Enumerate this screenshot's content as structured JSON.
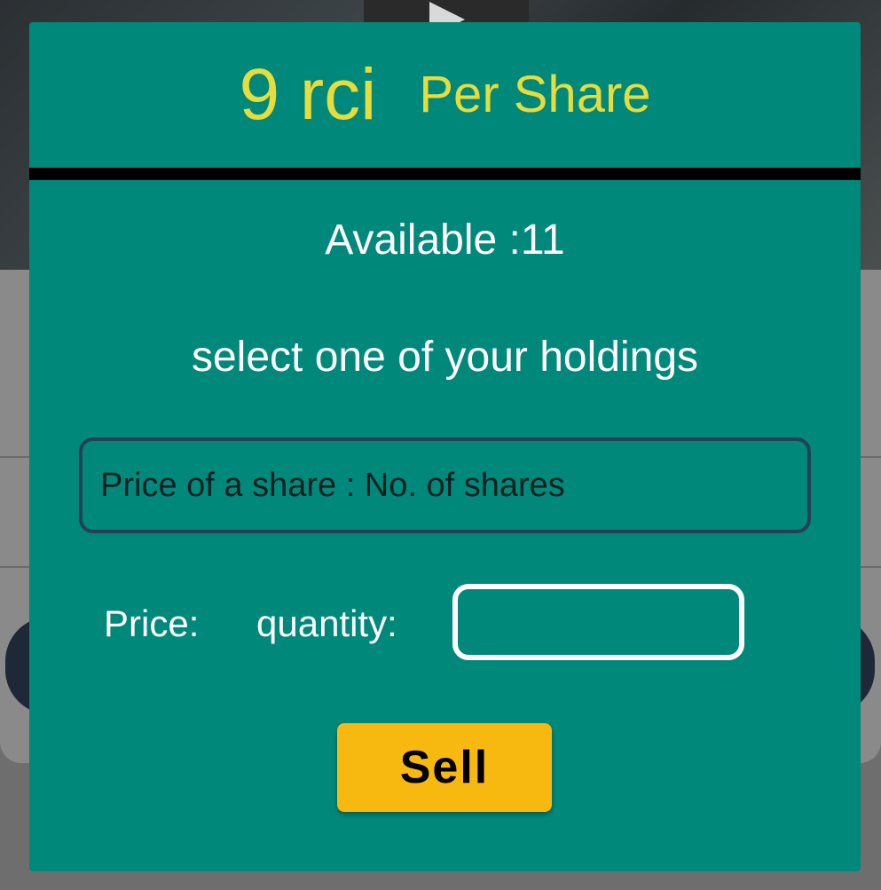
{
  "dialog": {
    "header": {
      "price_value": "9 rci",
      "price_unit": "Per Share"
    },
    "available_text": "Available :11",
    "instruction": "select one of your holdings",
    "holdings_select": {
      "selected_text": "Price of a share : No. of shares"
    },
    "price_label": "Price:",
    "quantity_label": "quantity:",
    "quantity_input": {
      "value": "",
      "placeholder": ""
    },
    "sell_label": "Sell"
  },
  "colors": {
    "dialog_bg": "#00897b",
    "header_text": "#e6dc3c",
    "sell_button": "#f7b80f",
    "select_border": "#264056"
  }
}
